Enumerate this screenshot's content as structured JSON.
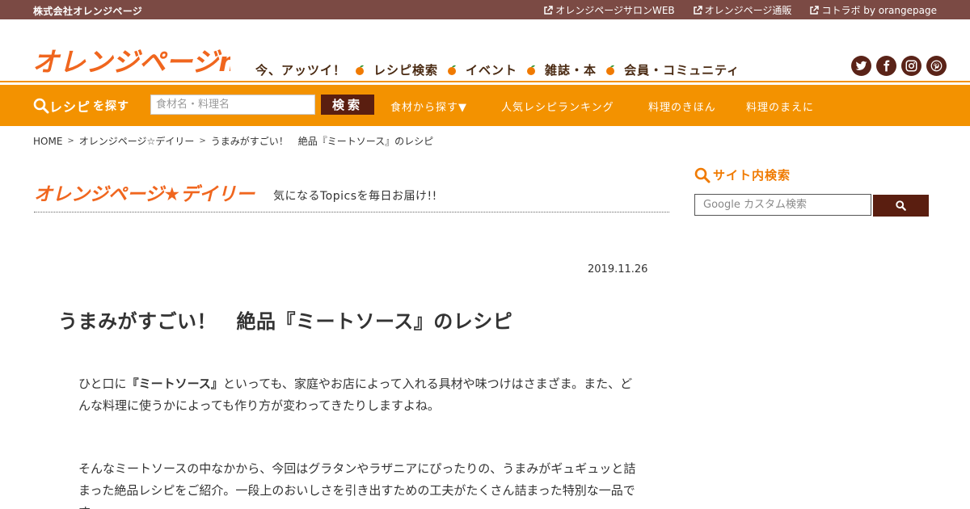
{
  "topbar": {
    "company": "株式会社オレンジページ",
    "links": [
      {
        "label": "オレンジページサロンWEB",
        "icon": "external-link-icon"
      },
      {
        "label": "オレンジページ通販",
        "icon": "external-link-icon"
      },
      {
        "label": "コトラボ by orangepage",
        "icon": "external-link-icon"
      }
    ]
  },
  "header": {
    "logo_text": "オレンジページnet",
    "nav": [
      "今、アッツイ！",
      "レシピ検索",
      "イベント",
      "雑誌・本",
      "会員・コミュニティ"
    ],
    "social": [
      "twitter-icon",
      "facebook-icon",
      "instagram-icon",
      "pinterest-icon"
    ]
  },
  "searchbar": {
    "label_main": "レシピ",
    "label_sub": "を探す",
    "placeholder": "食材名・料理名",
    "button": "検索",
    "links": [
      "食材から探す▼",
      "人気レシピランキング",
      "料理のきほん",
      "料理のまえに"
    ]
  },
  "breadcrumb": [
    "HOME",
    "オレンジページ☆デイリー",
    "うまみがすごい！　絶品『ミートソース』のレシピ"
  ],
  "daily": {
    "logo_text": "オレンジページ★デイリー",
    "tagline": "気になるTopicsを毎日お届け!!"
  },
  "article": {
    "date": "2019.11.26",
    "title": "うまみがすごい！　絶品『ミートソース』のレシピ",
    "para1_pre": "ひと口に",
    "para1_bold": "『ミートソース』",
    "para1_post": "といっても、家庭やお店によって入れる具材や味つけはさまざま。また、どんな料理に使うかによっても作り方が変わってきたりしますよね。",
    "para2": "そんなミートソースの中なかから、今回はグラタンやラザニアにぴったりの、うまみがギュギュッと詰まった絶品レシピをご紹介。一段上のおいしさを引き出すための工夫がたくさん詰まった特別な一品です。"
  },
  "sidebar": {
    "title": "サイト内検索",
    "placeholder": "Google カスタム検索"
  },
  "colors": {
    "brand_orange": "#f39200",
    "brown": "#5a1e10",
    "topbar": "#7b4a44",
    "logo_orange": "#f0661e"
  }
}
